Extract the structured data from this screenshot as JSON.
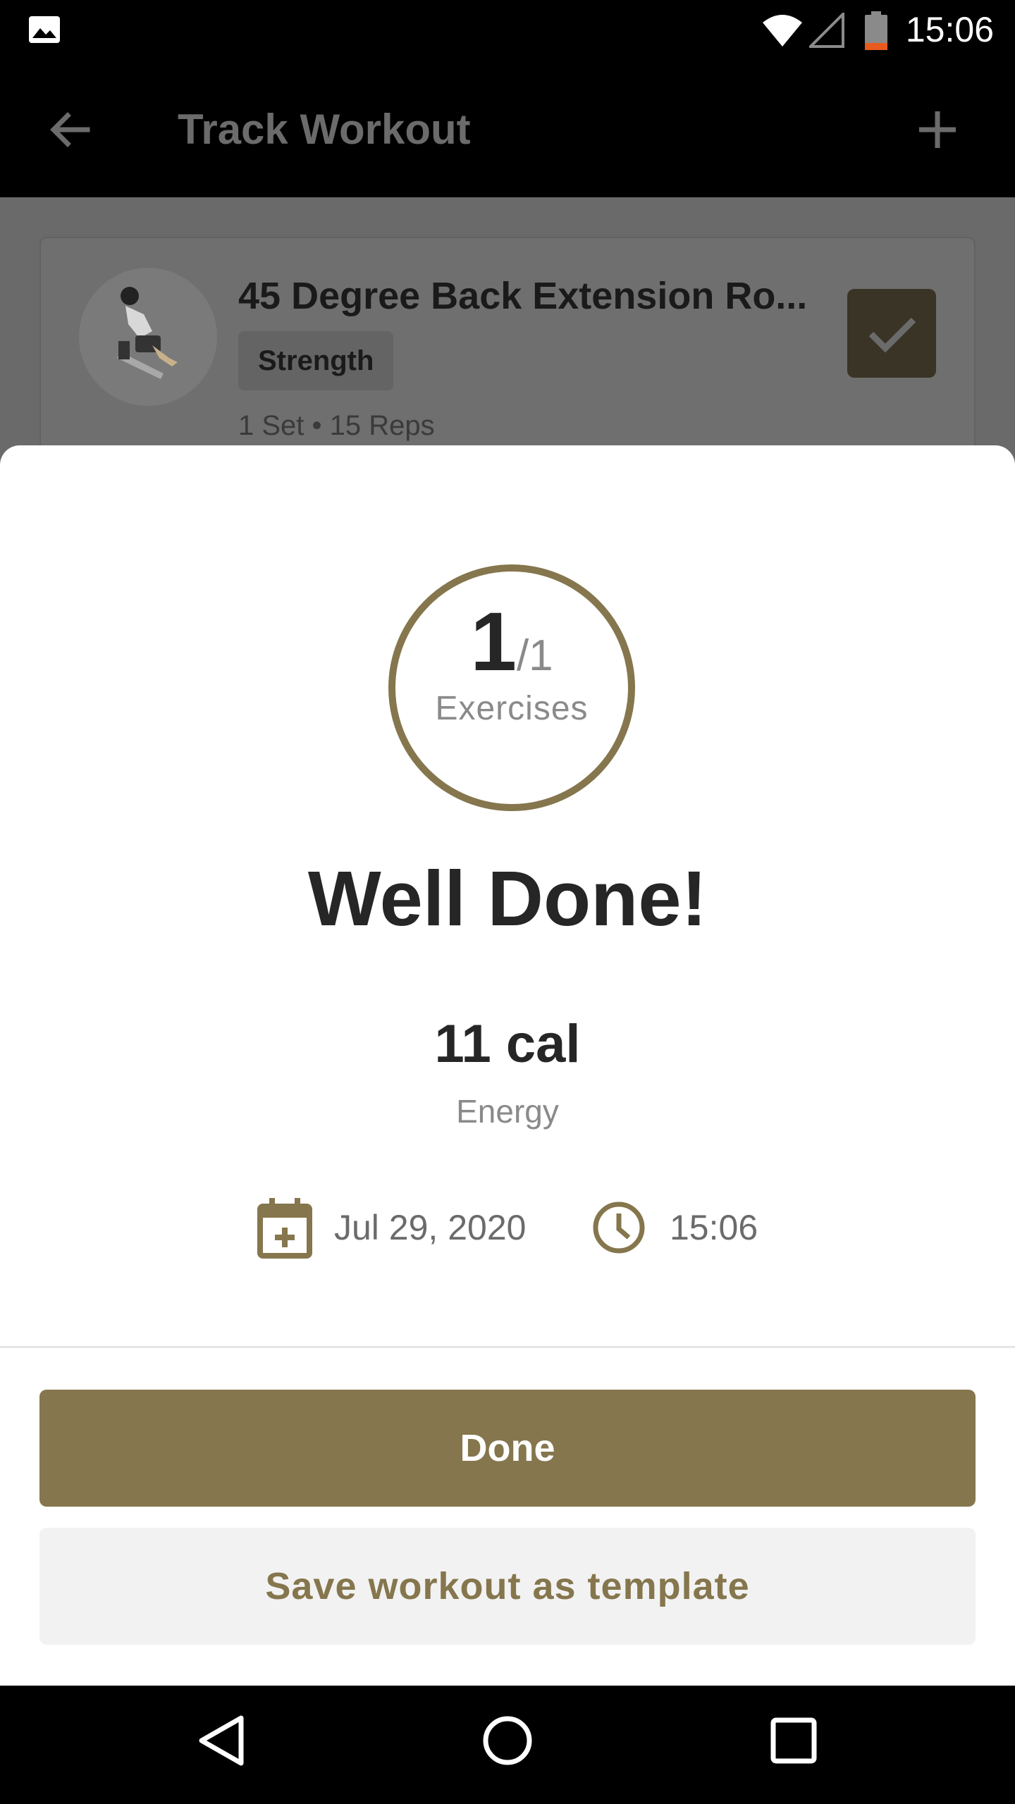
{
  "status_bar": {
    "time": "15:06",
    "icons": [
      "gallery-icon",
      "wifi-icon",
      "signal-icon",
      "battery-icon"
    ]
  },
  "app_bar": {
    "title": "Track Workout",
    "back_icon": "arrow-left-icon",
    "add_icon": "plus-icon"
  },
  "exercise_card": {
    "name": "45 Degree Back Extension Ro...",
    "tag": "Strength",
    "meta": "1 Set • 15 Reps",
    "checked": true
  },
  "summary": {
    "completed": "1",
    "total": "/1",
    "progress_label": "Exercises",
    "progress_fraction": 1.0,
    "headline": "Well Done!",
    "energy_value": "11 cal",
    "energy_label": "Energy",
    "date": "Jul 29, 2020",
    "time": "15:06"
  },
  "actions": {
    "done_label": "Done",
    "template_label": "Save workout as template"
  },
  "colors": {
    "accent": "#85764d",
    "ring": "#85764d",
    "text_dark": "#262626",
    "text_muted": "#8a8a8a"
  },
  "nav_bar": {
    "icons": [
      "nav-back-icon",
      "nav-home-icon",
      "nav-recents-icon"
    ]
  }
}
